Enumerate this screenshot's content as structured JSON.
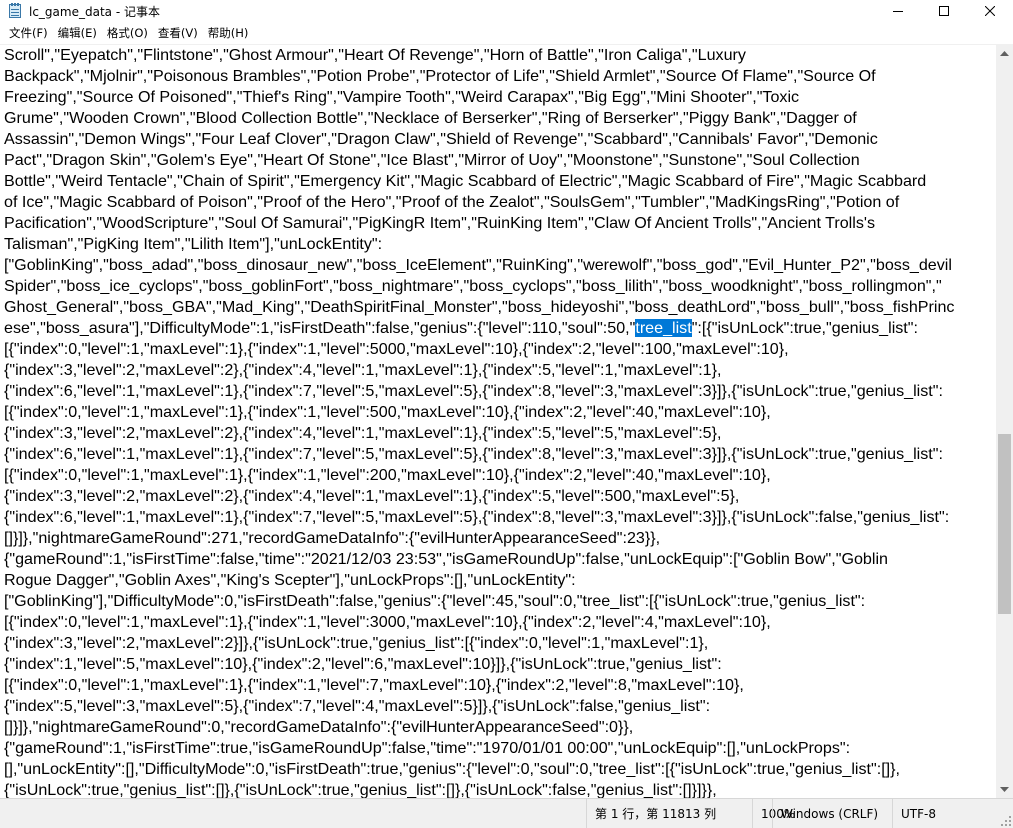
{
  "window": {
    "title": "lc_game_data - 记事本",
    "minimize_glyph": "—",
    "maximize_glyph": "☐",
    "close_glyph": "✕"
  },
  "menu": {
    "items": [
      "文件(F)",
      "编辑(E)",
      "格式(O)",
      "查看(V)",
      "帮助(H)"
    ]
  },
  "editor": {
    "selected_text": "tree_list",
    "lines": [
      "Scroll\",\"Eyepatch\",\"Flintstone\",\"Ghost Armour\",\"Heart Of Revenge\",\"Horn of Battle\",\"Iron Caliga\",\"Luxury",
      "Backpack\",\"Mjolnir\",\"Poisonous Brambles\",\"Potion Probe\",\"Protector of Life\",\"Shield Armlet\",\"Source Of Flame\",\"Source Of",
      "Freezing\",\"Source Of Poisoned\",\"Thief's Ring\",\"Vampire Tooth\",\"Weird Carapax\",\"Big Egg\",\"Mini Shooter\",\"Toxic",
      "Grume\",\"Wooden Crown\",\"Blood Collection Bottle\",\"Necklace of Berserker\",\"Ring of Berserker\",\"Piggy Bank\",\"Dagger of",
      "Assassin\",\"Demon Wings\",\"Four Leaf Clover\",\"Dragon Claw\",\"Shield of Revenge\",\"Scabbard\",\"Cannibals' Favor\",\"Demonic",
      "Pact\",\"Dragon Skin\",\"Golem's Eye\",\"Heart Of Stone\",\"Ice Blast\",\"Mirror of Uoy\",\"Moonstone\",\"Sunstone\",\"Soul Collection",
      "Bottle\",\"Weird Tentacle\",\"Chain of Spirit\",\"Emergency Kit\",\"Magic Scabbard of Electric\",\"Magic Scabbard of Fire\",\"Magic Scabbard",
      "of Ice\",\"Magic Scabbard of Poison\",\"Proof of the Hero\",\"Proof of the Zealot\",\"SoulsGem\",\"Tumbler\",\"MadKingsRing\",\"Potion of",
      "Pacification\",\"WoodScripture\",\"Soul Of Samurai\",\"PigKingR Item\",\"RuinKing Item\",\"Claw Of Ancient Trolls\",\"Ancient Trolls's",
      "Talisman\",\"PigKing Item\",\"Lilith Item\"],\"unLockEntity\":",
      "[\"GoblinKing\",\"boss_adad\",\"boss_dinosaur_new\",\"boss_IceElement\",\"RuinKing\",\"werewolf\",\"boss_god\",\"Evil_Hunter_P2\",\"boss_devil",
      "Spider\",\"boss_ice_cyclops\",\"boss_goblinFort\",\"boss_nightmare\",\"boss_cyclops\",\"boss_lilith\",\"boss_woodknight\",\"boss_rollingmon\",\"",
      "Ghost_General\",\"boss_GBA\",\"Mad_King\",\"DeathSpiritFinal_Monster\",\"boss_hideyoshi\",\"boss_deathLord\",\"boss_bull\",\"boss_fishPrinc",
      "ese\",\"boss_asura\"],\"DifficultyMode\":1,\"isFirstDeath\":false,\"genius\":{\"level\":110,\"soul\":50,\"tree_list\":[{\"isUnLock\":true,\"genius_list\":",
      "[{\"index\":0,\"level\":1,\"maxLevel\":1},{\"index\":1,\"level\":5000,\"maxLevel\":10},{\"index\":2,\"level\":100,\"maxLevel\":10},",
      "{\"index\":3,\"level\":2,\"maxLevel\":2},{\"index\":4,\"level\":1,\"maxLevel\":1},{\"index\":5,\"level\":1,\"maxLevel\":1},",
      "{\"index\":6,\"level\":1,\"maxLevel\":1},{\"index\":7,\"level\":5,\"maxLevel\":5},{\"index\":8,\"level\":3,\"maxLevel\":3}]},{\"isUnLock\":true,\"genius_list\":",
      "[{\"index\":0,\"level\":1,\"maxLevel\":1},{\"index\":1,\"level\":500,\"maxLevel\":10},{\"index\":2,\"level\":40,\"maxLevel\":10},",
      "{\"index\":3,\"level\":2,\"maxLevel\":2},{\"index\":4,\"level\":1,\"maxLevel\":1},{\"index\":5,\"level\":5,\"maxLevel\":5},",
      "{\"index\":6,\"level\":1,\"maxLevel\":1},{\"index\":7,\"level\":5,\"maxLevel\":5},{\"index\":8,\"level\":3,\"maxLevel\":3}]},{\"isUnLock\":true,\"genius_list\":",
      "[{\"index\":0,\"level\":1,\"maxLevel\":1},{\"index\":1,\"level\":200,\"maxLevel\":10},{\"index\":2,\"level\":40,\"maxLevel\":10},",
      "{\"index\":3,\"level\":2,\"maxLevel\":2},{\"index\":4,\"level\":1,\"maxLevel\":1},{\"index\":5,\"level\":500,\"maxLevel\":5},",
      "{\"index\":6,\"level\":1,\"maxLevel\":1},{\"index\":7,\"level\":5,\"maxLevel\":5},{\"index\":8,\"level\":3,\"maxLevel\":3}]},{\"isUnLock\":false,\"genius_list\":",
      "[]}]},\"nightmareGameRound\":271,\"recordGameDataInfo\":{\"evilHunterAppearanceSeed\":23}},",
      "{\"gameRound\":1,\"isFirstTime\":false,\"time\":\"2021/12/03 23:53\",\"isGameRoundUp\":false,\"unLockEquip\":[\"Goblin Bow\",\"Goblin",
      "Rogue Dagger\",\"Goblin Axes\",\"King's Scepter\"],\"unLockProps\":[],\"unLockEntity\":",
      "[\"GoblinKing\"],\"DifficultyMode\":0,\"isFirstDeath\":false,\"genius\":{\"level\":45,\"soul\":0,\"tree_list\":[{\"isUnLock\":true,\"genius_list\":",
      "[{\"index\":0,\"level\":1,\"maxLevel\":1},{\"index\":1,\"level\":3000,\"maxLevel\":10},{\"index\":2,\"level\":4,\"maxLevel\":10},",
      "{\"index\":3,\"level\":2,\"maxLevel\":2}]},{\"isUnLock\":true,\"genius_list\":[{\"index\":0,\"level\":1,\"maxLevel\":1},",
      "{\"index\":1,\"level\":5,\"maxLevel\":10},{\"index\":2,\"level\":6,\"maxLevel\":10}]},{\"isUnLock\":true,\"genius_list\":",
      "[{\"index\":0,\"level\":1,\"maxLevel\":1},{\"index\":1,\"level\":7,\"maxLevel\":10},{\"index\":2,\"level\":8,\"maxLevel\":10},",
      "{\"index\":5,\"level\":3,\"maxLevel\":5},{\"index\":7,\"level\":4,\"maxLevel\":5}]},{\"isUnLock\":false,\"genius_list\":",
      "[]}]},\"nightmareGameRound\":0,\"recordGameDataInfo\":{\"evilHunterAppearanceSeed\":0}},",
      "{\"gameRound\":1,\"isFirstTime\":true,\"isGameRoundUp\":false,\"time\":\"1970/01/01 00:00\",\"unLockEquip\":[],\"unLockProps\":",
      "[],\"unLockEntity\":[],\"DifficultyMode\":0,\"isFirstDeath\":true,\"genius\":{\"level\":0,\"soul\":0,\"tree_list\":[{\"isUnLock\":true,\"genius_list\":[]},",
      "{\"isUnLock\":true,\"genius_list\":[]},{\"isUnLock\":true,\"genius_list\":[]},{\"isUnLock\":false,\"genius_list\":[]}]}},"
    ]
  },
  "scrollbar": {
    "position": 0.69,
    "thumb_fraction": 0.25,
    "up_arrow_glyph": "▲",
    "down_arrow_glyph": "▼"
  },
  "status": {
    "position": "第 1 行，第 11813 列",
    "zoom": "100%",
    "line_ending": "Windows (CRLF)",
    "encoding": "UTF-8"
  },
  "colors": {
    "selection_bg": "#0078d7",
    "selection_fg": "#ffffff",
    "chrome_bg": "#f0f0f0",
    "scroll_thumb": "#c1c1c1"
  }
}
